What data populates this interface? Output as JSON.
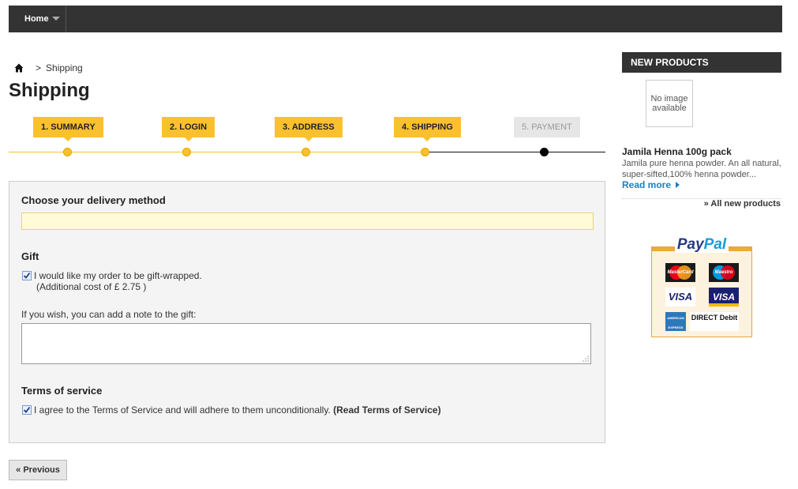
{
  "nav": {
    "home_label": "Home"
  },
  "breadcrumb": {
    "separator": ">",
    "current": "Shipping"
  },
  "page_title": "Shipping",
  "steps": [
    {
      "label": "1. SUMMARY"
    },
    {
      "label": "2. LOGIN"
    },
    {
      "label": "3. ADDRESS"
    },
    {
      "label": "4. SHIPPING"
    },
    {
      "label": "5. PAYMENT"
    }
  ],
  "delivery": {
    "heading": "Choose your delivery method"
  },
  "gift": {
    "heading": "Gift",
    "checkbox_label": "I would like my order to be gift-wrapped.",
    "additional_cost": "(Additional cost of £ 2.75 )",
    "checked": true,
    "note_label": "If you wish, you can add a note to the gift:",
    "note_value": ""
  },
  "terms": {
    "heading": "Terms of service",
    "checkbox_label": "I agree to the Terms of Service and will adhere to them unconditionally.",
    "link_label": "(Read Terms of Service)",
    "checked": true
  },
  "buttons": {
    "previous_label": "« Previous"
  },
  "sidebar": {
    "new_products_heading": "NEW PRODUCTS",
    "no_image_line1": "No image",
    "no_image_line2": "available",
    "product_name": "Jamila Henna 100g pack",
    "product_description": "Jamila pure henna powder. An all natural, super-sifted,100% henna powder...",
    "read_more": "Read more",
    "all_new_products": "» All new products"
  },
  "paypal": {
    "logo_pay": "Pay",
    "logo_pal": "Pal",
    "cards": [
      "MasterCard",
      "Maestro",
      "VISA",
      "VISA",
      "AMERICAN EXPRESS",
      "DIRECT Debit"
    ]
  },
  "colors": {
    "accent": "#fbc02d",
    "nav_bg": "#333333",
    "link": "#1a7fc1"
  }
}
